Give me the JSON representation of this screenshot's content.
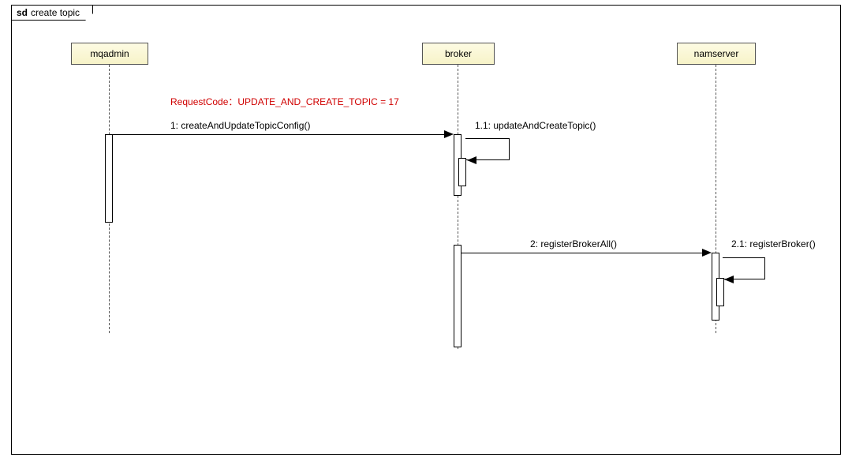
{
  "frame": {
    "prefix": "sd",
    "title": "create topic"
  },
  "participants": {
    "mqadmin": "mqadmin",
    "broker": "broker",
    "namserver": "namserver"
  },
  "note": "RequestCode：UPDATE_AND_CREATE_TOPIC = 17",
  "messages": {
    "m1": "1: createAndUpdateTopicConfig()",
    "m1_1": "1.1: updateAndCreateTopic()",
    "m2": "2: registerBrokerAll()",
    "m2_1": "2.1: registerBroker()"
  },
  "diagram_data": {
    "type": "sequence",
    "participants": [
      "mqadmin",
      "broker",
      "namserver"
    ],
    "messages": [
      {
        "from": "mqadmin",
        "to": "broker",
        "label": "1: createAndUpdateTopicConfig()",
        "note": "RequestCode：UPDATE_AND_CREATE_TOPIC = 17"
      },
      {
        "from": "broker",
        "to": "broker",
        "label": "1.1: updateAndCreateTopic()"
      },
      {
        "from": "broker",
        "to": "namserver",
        "label": "2: registerBrokerAll()"
      },
      {
        "from": "namserver",
        "to": "namserver",
        "label": "2.1: registerBroker()"
      }
    ]
  }
}
